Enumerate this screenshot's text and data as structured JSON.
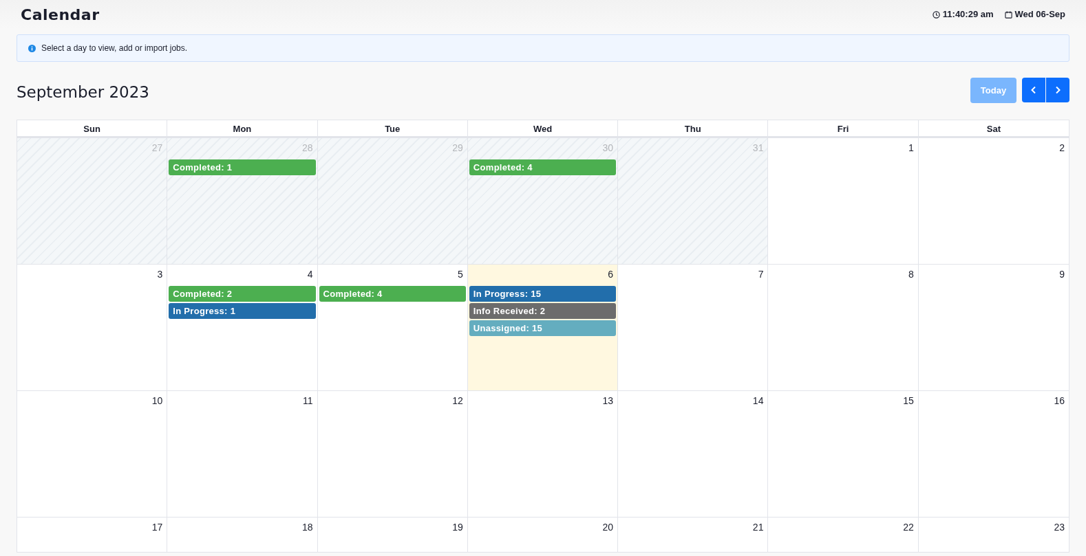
{
  "page_title": "Calendar",
  "clock": {
    "time": "11:40:29 am",
    "date": "Wed 06-Sep"
  },
  "info_alert": "Select a day to view, add or import jobs.",
  "month_title": "September 2023",
  "today_button": {
    "label": "Today",
    "disabled": true
  },
  "weekdays": [
    "Sun",
    "Mon",
    "Tue",
    "Wed",
    "Thu",
    "Fri",
    "Sat"
  ],
  "weeks": [
    {
      "days": [
        {
          "number": "27",
          "other_month": true,
          "today": false
        },
        {
          "number": "28",
          "other_month": true,
          "today": false,
          "events": [
            {
              "label": "Completed: 1",
              "color": "#4caf50"
            }
          ]
        },
        {
          "number": "29",
          "other_month": true,
          "today": false
        },
        {
          "number": "30",
          "other_month": true,
          "today": false,
          "events": [
            {
              "label": "Completed: 4",
              "color": "#4caf50"
            }
          ]
        },
        {
          "number": "31",
          "other_month": true,
          "today": false
        },
        {
          "number": "1",
          "other_month": false,
          "today": false
        },
        {
          "number": "2",
          "other_month": false,
          "today": false
        }
      ]
    },
    {
      "days": [
        {
          "number": "3",
          "other_month": false,
          "today": false
        },
        {
          "number": "4",
          "other_month": false,
          "today": false,
          "events": [
            {
              "label": "Completed: 2",
              "color": "#4caf50"
            },
            {
              "label": "In Progress: 1",
              "color": "#226eab"
            }
          ]
        },
        {
          "number": "5",
          "other_month": false,
          "today": false,
          "events": [
            {
              "label": "Completed: 4",
              "color": "#4caf50"
            }
          ]
        },
        {
          "number": "6",
          "other_month": false,
          "today": true,
          "events": [
            {
              "label": "In Progress: 15",
              "color": "#226eab"
            },
            {
              "label": "Info Received: 2",
              "color": "#6c6c6c"
            },
            {
              "label": "Unassigned: 15",
              "color": "#64adbf"
            }
          ]
        },
        {
          "number": "7",
          "other_month": false,
          "today": false
        },
        {
          "number": "8",
          "other_month": false,
          "today": false
        },
        {
          "number": "9",
          "other_month": false,
          "today": false
        }
      ]
    },
    {
      "days": [
        {
          "number": "10",
          "other_month": false,
          "today": false
        },
        {
          "number": "11",
          "other_month": false,
          "today": false
        },
        {
          "number": "12",
          "other_month": false,
          "today": false
        },
        {
          "number": "13",
          "other_month": false,
          "today": false
        },
        {
          "number": "14",
          "other_month": false,
          "today": false
        },
        {
          "number": "15",
          "other_month": false,
          "today": false
        },
        {
          "number": "16",
          "other_month": false,
          "today": false
        }
      ]
    },
    {
      "days": [
        {
          "number": "17",
          "other_month": false,
          "today": false
        },
        {
          "number": "18",
          "other_month": false,
          "today": false
        },
        {
          "number": "19",
          "other_month": false,
          "today": false
        },
        {
          "number": "20",
          "other_month": false,
          "today": false
        },
        {
          "number": "21",
          "other_month": false,
          "today": false
        },
        {
          "number": "22",
          "other_month": false,
          "today": false
        },
        {
          "number": "23",
          "other_month": false,
          "today": false
        }
      ]
    }
  ]
}
